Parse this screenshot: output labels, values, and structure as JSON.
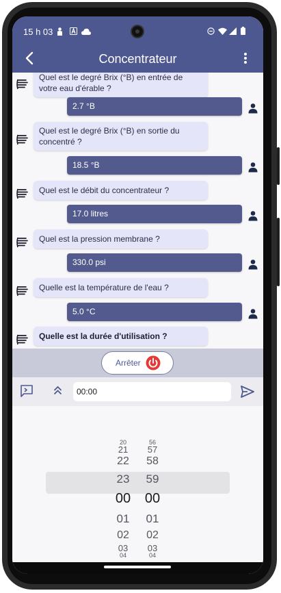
{
  "status": {
    "time": "15 h 03"
  },
  "appbar": {
    "title": "Concentrateur"
  },
  "messages": [
    {
      "from": "bot",
      "text": "Quel est le degré Brix (°B) en entrée de votre eau d'érable ?"
    },
    {
      "from": "user",
      "text": "2.7 °B"
    },
    {
      "from": "bot",
      "text": "Quel est le degré Brix (°B) en sortie du concentré ?"
    },
    {
      "from": "user",
      "text": "18.5 °B"
    },
    {
      "from": "bot",
      "text": "Quel est le débit du concentrateur ?"
    },
    {
      "from": "user",
      "text": "17.0 litres"
    },
    {
      "from": "bot",
      "text": "Quel est la pression membrane ?"
    },
    {
      "from": "user",
      "text": "330.0 psi"
    },
    {
      "from": "bot",
      "text": "Quelle est la température de l'eau ?"
    },
    {
      "from": "user",
      "text": "5.0 °C"
    },
    {
      "from": "bot",
      "text": "Quelle est la durée d'utilisation ?"
    }
  ],
  "stop_button": {
    "label": "Arrêter"
  },
  "input": {
    "value": "00:00"
  },
  "picker": {
    "hours": [
      "20",
      "21",
      "22",
      "23",
      "00",
      "01",
      "02",
      "03",
      "04"
    ],
    "minutes": [
      "56",
      "57",
      "58",
      "59",
      "00",
      "01",
      "02",
      "03",
      "04"
    ],
    "selected_hour": "00",
    "selected_minute": "00"
  },
  "colors": {
    "primary": "#4e5890",
    "user_bubble": "#535b8e",
    "bot_bubble": "#e4e5f8",
    "stop_red": "#e53935"
  }
}
